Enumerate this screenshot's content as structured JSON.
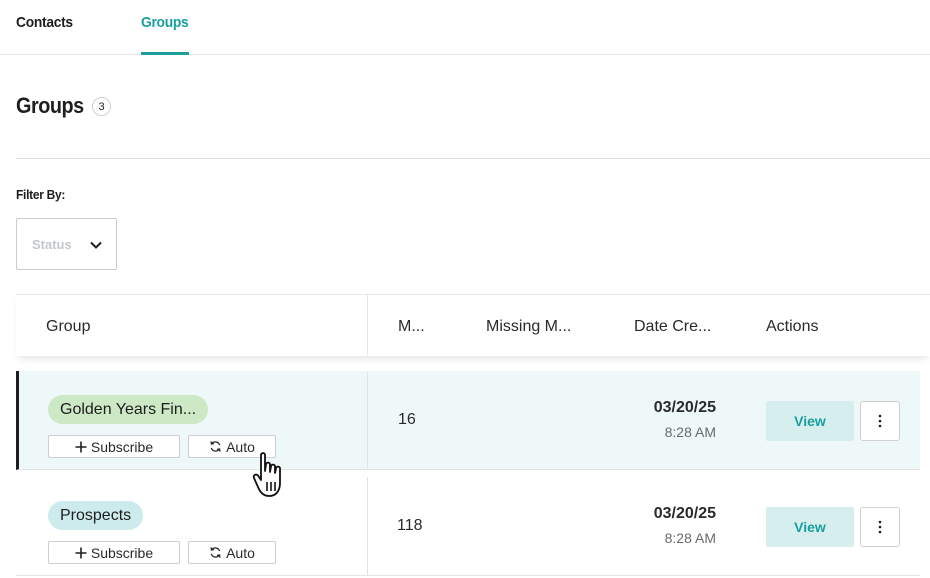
{
  "tabs": [
    {
      "label": "Contacts",
      "active": false
    },
    {
      "label": "Groups",
      "active": true
    }
  ],
  "page": {
    "title": "Groups",
    "count": "3"
  },
  "filter": {
    "label": "Filter By:",
    "status_placeholder": "Status"
  },
  "table": {
    "columns": [
      "Group",
      "M...",
      "Missing M...",
      "Date Cre...",
      "Actions"
    ],
    "rows": [
      {
        "group": "Golden Years Fin...",
        "tag_color": "#cde8c4",
        "subscribe_label": "Subscribe",
        "auto_label": "Auto",
        "members": "16",
        "missing": "",
        "date": "03/20/25",
        "time": "8:28 AM",
        "view_label": "View",
        "selected": true
      },
      {
        "group": "Prospects",
        "tag_color": "#cdebec",
        "subscribe_label": "Subscribe",
        "auto_label": "Auto",
        "members": "118",
        "missing": "",
        "date": "03/20/25",
        "time": "8:28 AM",
        "view_label": "View",
        "selected": false
      }
    ]
  },
  "colors": {
    "accent": "#1a9e9e",
    "selected_row_bg": "#eef8f8",
    "view_button_bg": "#d7eeee"
  },
  "icons": [
    "chevron-down-icon",
    "plus-icon",
    "sync-icon",
    "more-vertical-icon",
    "hand-pointer-cursor-icon"
  ]
}
